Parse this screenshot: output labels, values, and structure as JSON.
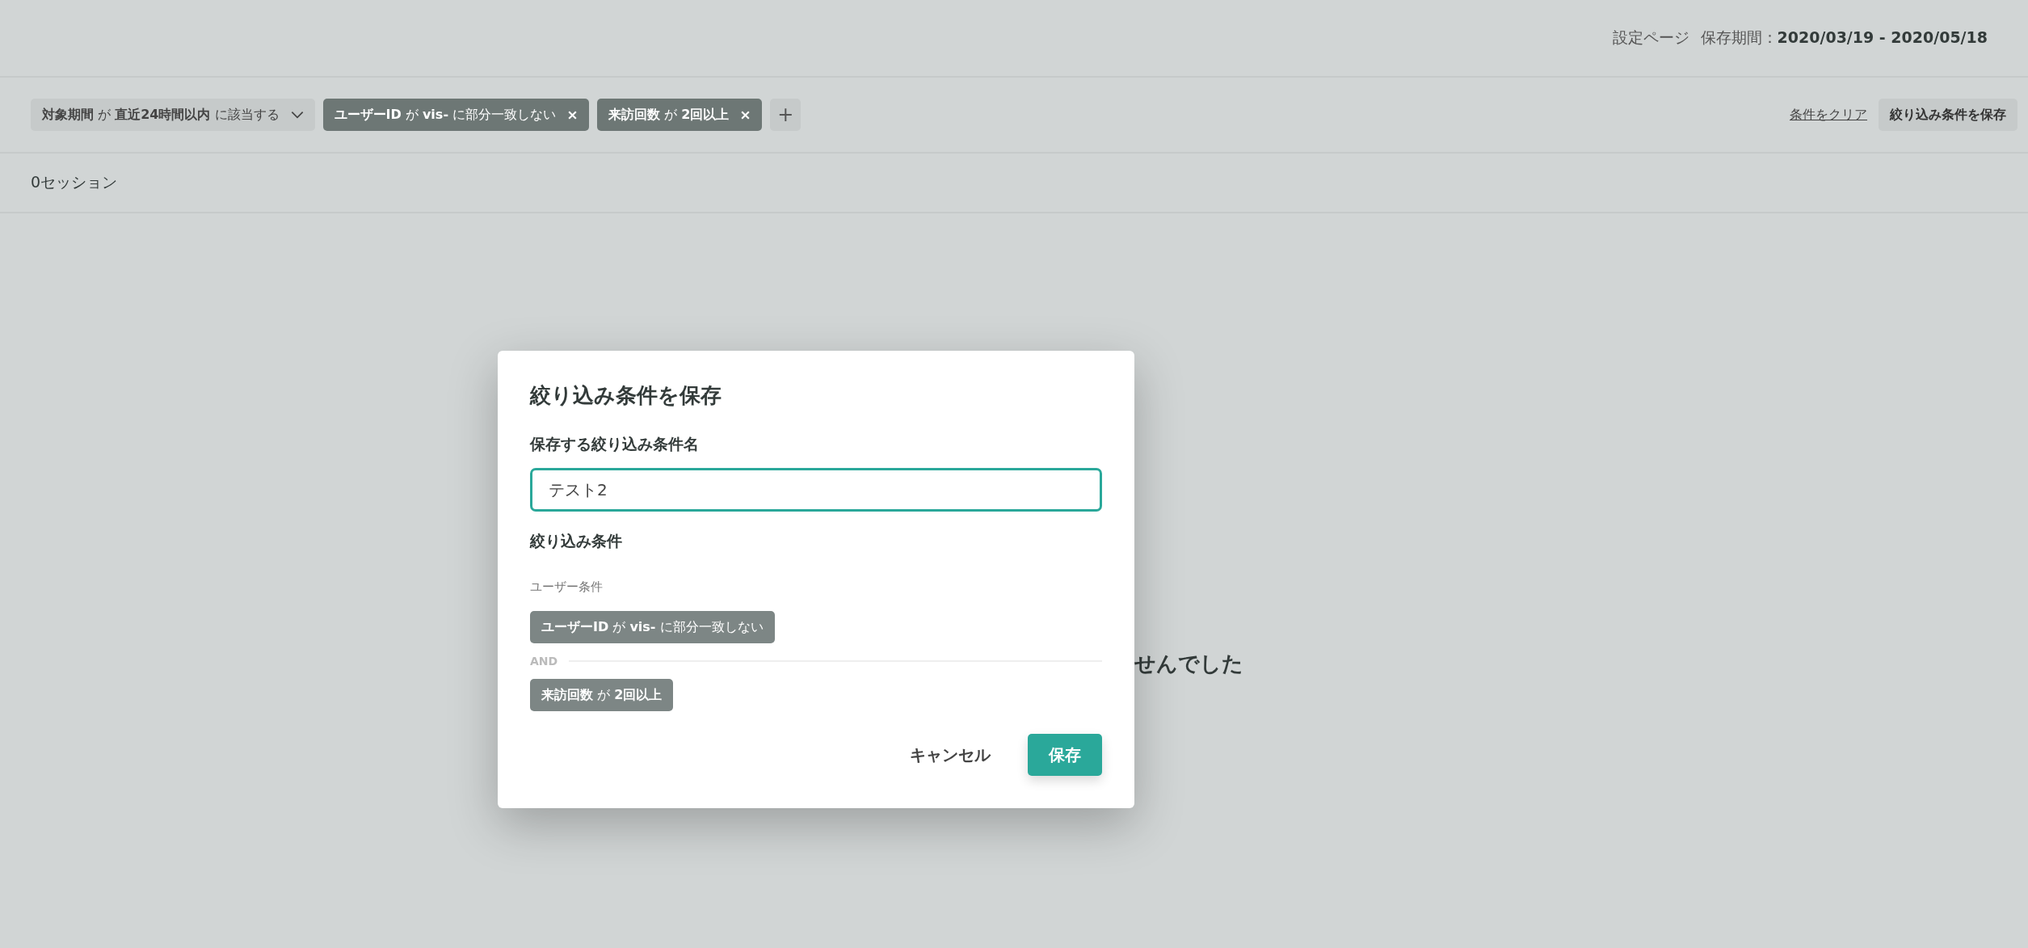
{
  "header": {
    "page_label": "設定ページ",
    "retention": "保存期間：**2020/03/19 - 2020/05/18**"
  },
  "filters": [
    {
      "kind": "dropdown",
      "text": "**対象期間** が **直近24時間以内** に該当する"
    },
    {
      "kind": "removable",
      "text": "**ユーザーID** が **vis-** に部分一致しない"
    },
    {
      "kind": "removable",
      "text": "**来訪回数** が **2回以上**"
    }
  ],
  "filter_actions": {
    "add": "+",
    "clear": "条件をクリア",
    "save": "絞り込み条件を保存"
  },
  "session_count": "0セッション",
  "empty_message": "せんでした",
  "dialog": {
    "title": "絞り込み条件を保存",
    "name_label": "保存する絞り込み条件名",
    "name_value": "テスト2",
    "conditions_label": "絞り込み条件",
    "group_label": "ユーザー条件",
    "conditions": [
      {
        "kind": "chip",
        "text": "**ユーザーID** が **vis-** に部分一致しない"
      },
      {
        "kind": "separator",
        "text": "AND"
      },
      {
        "kind": "chip",
        "text": "**来訪回数** が **2回以上**"
      }
    ],
    "cancel": "キャンセル",
    "save": "保存"
  }
}
